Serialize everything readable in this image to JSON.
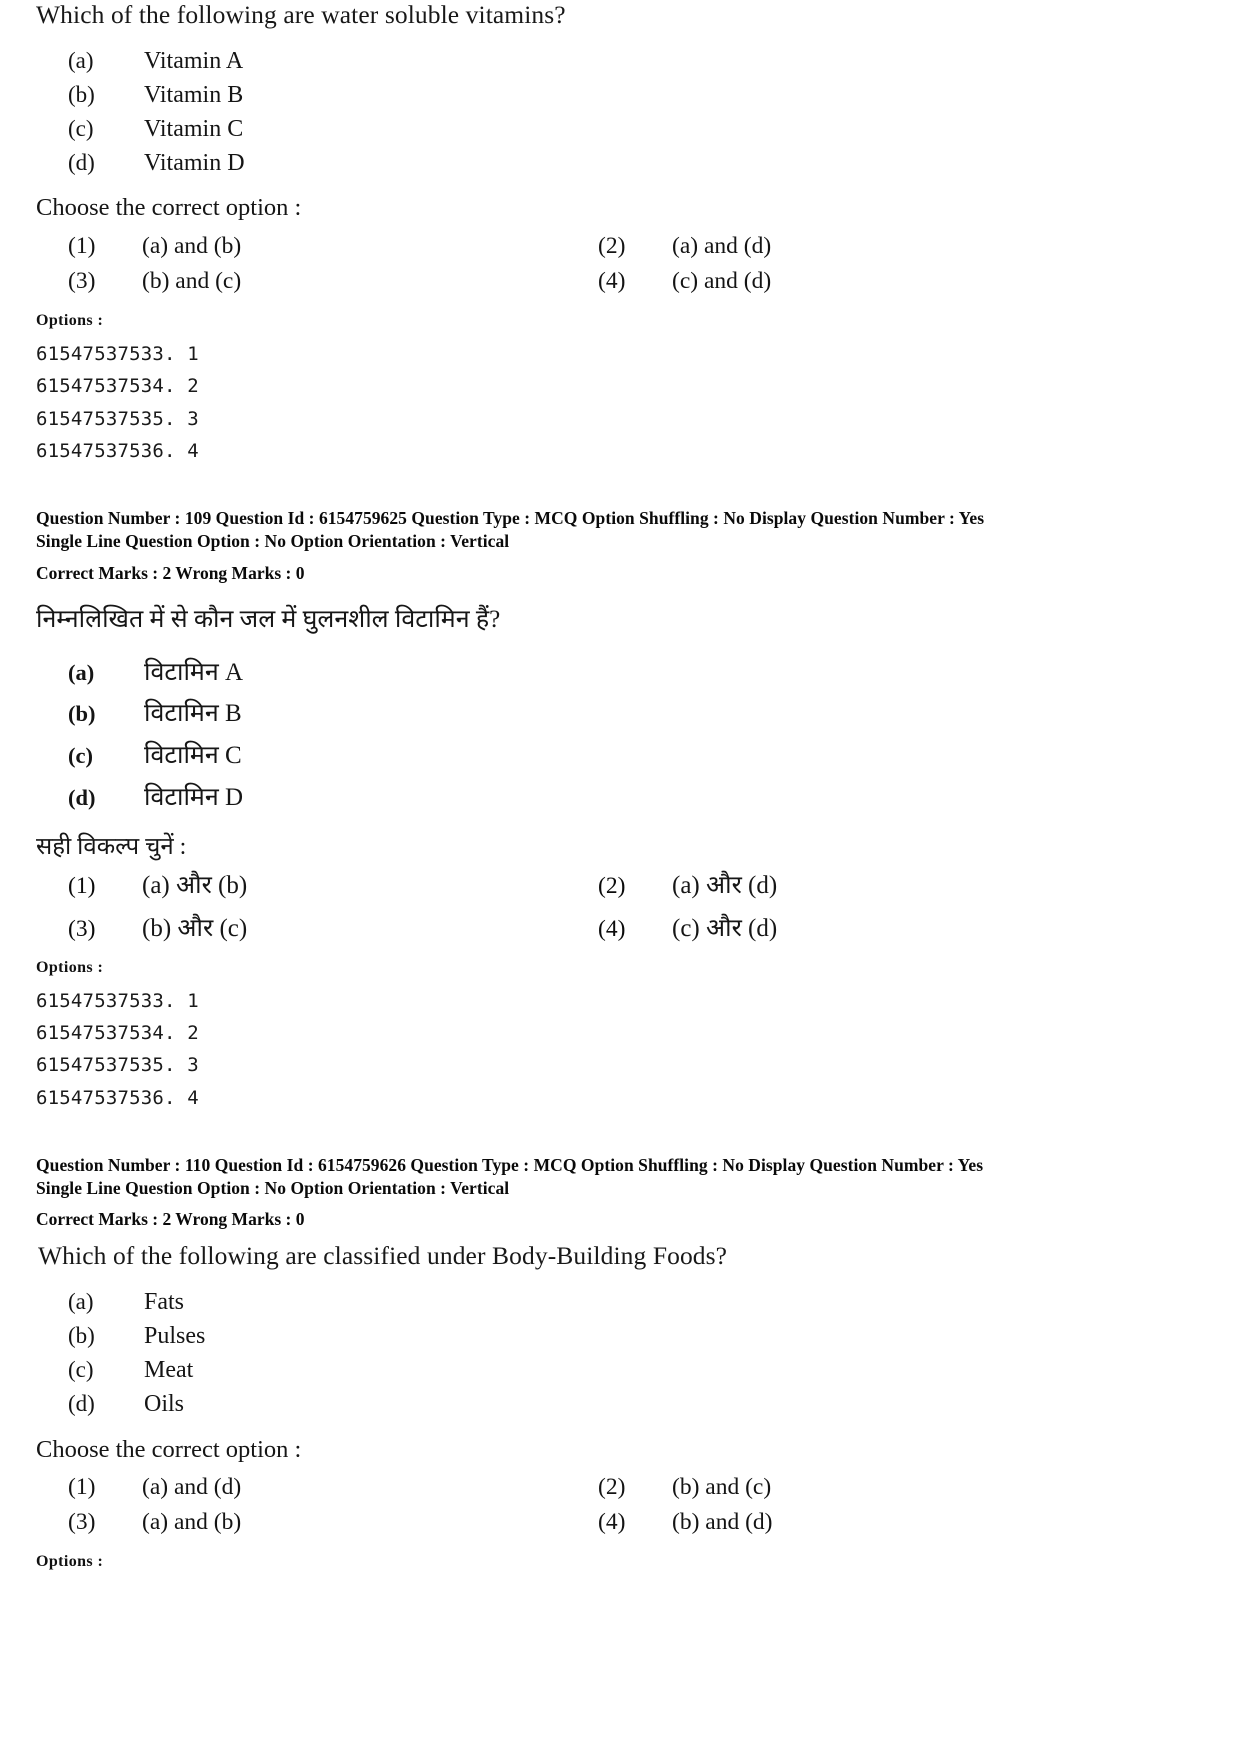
{
  "questions": [
    {
      "lang": "en",
      "stem": "Which of the following are water soluble vitamins?",
      "sub_options": [
        {
          "label": "(a)",
          "text": "Vitamin A"
        },
        {
          "label": "(b)",
          "text": "Vitamin B"
        },
        {
          "label": "(c)",
          "text": "Vitamin C"
        },
        {
          "label": "(d)",
          "text": "Vitamin D"
        }
      ],
      "choose_label": "Choose the correct option :",
      "choices": [
        {
          "num": "(1)",
          "text": "(a) and (b)"
        },
        {
          "num": "(2)",
          "text": "(a) and (d)"
        },
        {
          "num": "(3)",
          "text": "(b) and (c)"
        },
        {
          "num": "(4)",
          "text": "(c) and (d)"
        }
      ],
      "options_label": "Options :",
      "option_ids": [
        "61547537533. 1",
        "61547537534. 2",
        "61547537535. 3",
        "61547537536. 4"
      ]
    },
    {
      "lang": "hi",
      "meta_line1": "Question Number : 109  Question Id : 6154759625  Question Type : MCQ  Option Shuffling : No  Display Question Number : Yes",
      "meta_line2": "Single Line Question Option : No  Option Orientation : Vertical",
      "meta_marks": "Correct Marks : 2  Wrong Marks : 0",
      "stem": "निम्नलिखित में से कौन जल में घुलनशील विटामिन हैं?",
      "sub_options": [
        {
          "label": "(a)",
          "text": "विटामिन A"
        },
        {
          "label": "(b)",
          "text": "विटामिन B"
        },
        {
          "label": "(c)",
          "text": "विटामिन C"
        },
        {
          "label": "(d)",
          "text": "विटामिन D"
        }
      ],
      "choose_label": "सही विकल्प चुनें :",
      "choices": [
        {
          "num": "(1)",
          "text": "(a) और (b)"
        },
        {
          "num": "(2)",
          "text": "(a) और (d)"
        },
        {
          "num": "(3)",
          "text": "(b) और (c)"
        },
        {
          "num": "(4)",
          "text": "(c) और (d)"
        }
      ],
      "options_label": "Options :",
      "option_ids": [
        "61547537533. 1",
        "61547537534. 2",
        "61547537535. 3",
        "61547537536. 4"
      ]
    },
    {
      "lang": "en",
      "meta_line1": "Question Number : 110  Question Id : 6154759626  Question Type : MCQ  Option Shuffling : No  Display Question Number : Yes",
      "meta_line2": "Single Line Question Option : No  Option Orientation : Vertical",
      "meta_marks": "Correct Marks : 2  Wrong Marks : 0",
      "stem": "Which of the following are classified under Body-Building Foods?",
      "sub_options": [
        {
          "label": "(a)",
          "text": "Fats"
        },
        {
          "label": "(b)",
          "text": "Pulses"
        },
        {
          "label": "(c)",
          "text": "Meat"
        },
        {
          "label": "(d)",
          "text": "Oils"
        }
      ],
      "choose_label": "Choose the correct option :",
      "choices": [
        {
          "num": "(1)",
          "text": "(a) and (d)"
        },
        {
          "num": "(2)",
          "text": "(b) and (c)"
        },
        {
          "num": "(3)",
          "text": "(a) and (b)"
        },
        {
          "num": "(4)",
          "text": "(b) and (d)"
        }
      ],
      "options_label": "Options :"
    }
  ]
}
